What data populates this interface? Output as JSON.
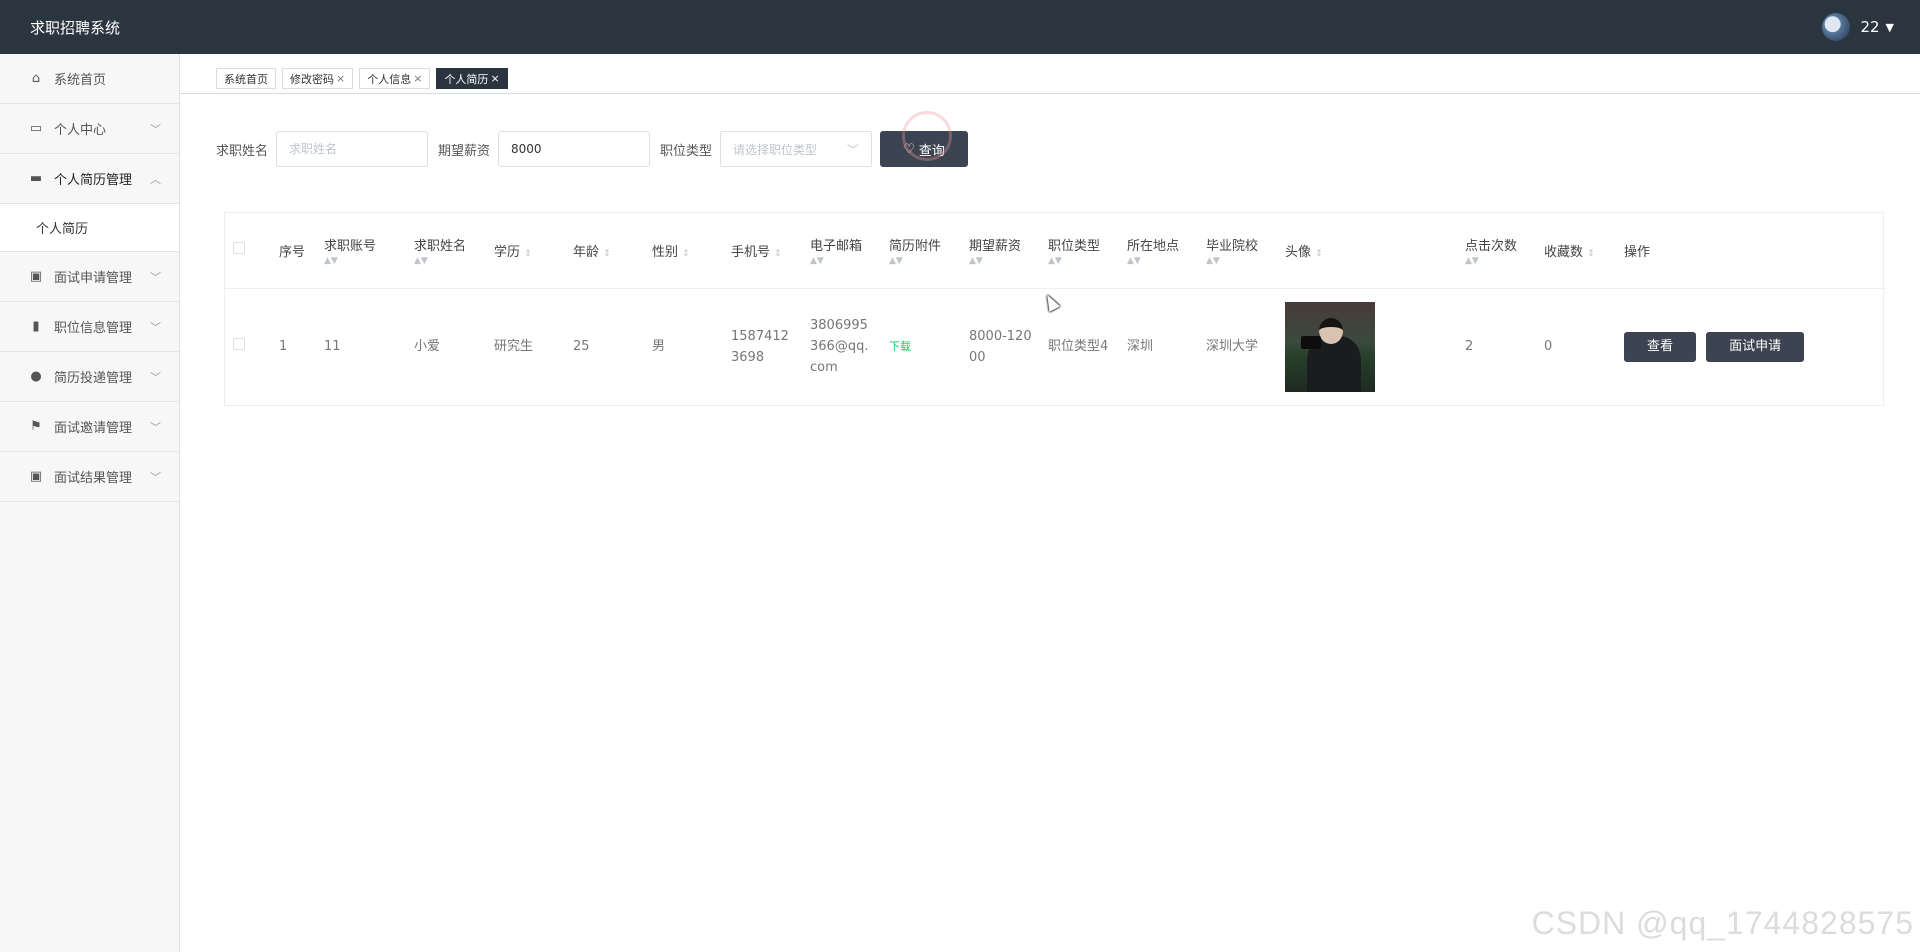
{
  "header": {
    "title": "求职招聘系统",
    "user": "22"
  },
  "sidebar": {
    "items": [
      {
        "label": "系统首页",
        "icon": "home-icon"
      },
      {
        "label": "个人中心",
        "icon": "calendar-icon"
      },
      {
        "label": "个人简历管理",
        "icon": "monitor-icon",
        "open": true,
        "children": [
          {
            "label": "个人简历"
          }
        ]
      },
      {
        "label": "面试申请管理",
        "icon": "clipboard-x-icon"
      },
      {
        "label": "职位信息管理",
        "icon": "bar-chart-icon"
      },
      {
        "label": "简历投递管理",
        "icon": "user-icon"
      },
      {
        "label": "面试邀请管理",
        "icon": "flag-icon"
      },
      {
        "label": "面试结果管理",
        "icon": "clipboard-check-icon"
      }
    ]
  },
  "tabs": [
    {
      "label": "系统首页",
      "closable": false,
      "active": false
    },
    {
      "label": "修改密码",
      "closable": true,
      "active": false
    },
    {
      "label": "个人信息",
      "closable": true,
      "active": false
    },
    {
      "label": "个人简历",
      "closable": true,
      "active": true
    }
  ],
  "search": {
    "name_label": "求职姓名",
    "name_placeholder": "求职姓名",
    "name_value": "",
    "salary_label": "期望薪资",
    "salary_value": "8000",
    "type_label": "职位类型",
    "type_placeholder": "请选择职位类型",
    "query_label": "查询"
  },
  "table": {
    "columns": [
      "序号",
      "求职账号",
      "求职姓名",
      "学历",
      "年龄",
      "性别",
      "手机号",
      "电子邮箱",
      "简历附件",
      "期望薪资",
      "职位类型",
      "所在地点",
      "毕业院校",
      "头像",
      "点击次数",
      "收藏数",
      "操作"
    ],
    "rows": [
      {
        "index": "1",
        "account": "11",
        "name": "小爱",
        "education": "研究生",
        "age": "25",
        "gender": "男",
        "phone": "15874123698",
        "email": "3806995366@qq.com",
        "attachment": "下载",
        "salary": "8000-12000",
        "job_type": "职位类型4",
        "location": "深圳",
        "school": "深圳大学",
        "avatar": "portrait-photo",
        "clicks": "2",
        "favorites": "0",
        "actions": {
          "view": "查看",
          "apply": "面试申请"
        }
      }
    ]
  },
  "watermark": "CSDN @qq_1744828575",
  "colors": {
    "topbar": "#2b3540",
    "button": "#3b4450",
    "link_green": "#13ce66"
  }
}
